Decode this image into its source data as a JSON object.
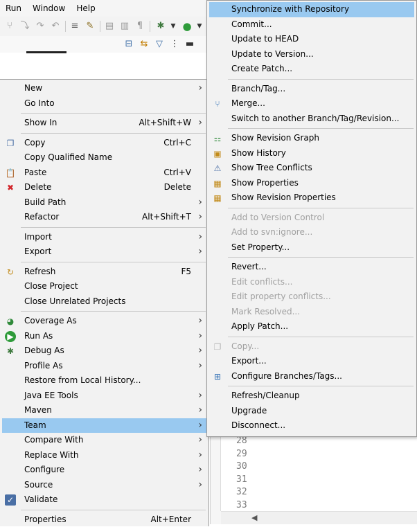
{
  "menubar": {
    "items": [
      "Run",
      "Window",
      "Help"
    ]
  },
  "editor": {
    "line_numbers": [
      "28",
      "29",
      "30",
      "31",
      "32",
      "33"
    ]
  },
  "context_menu": {
    "items": [
      {
        "label": "New",
        "accel": "",
        "submenu": true,
        "icon": ""
      },
      {
        "label": "Go Into",
        "accel": "",
        "submenu": false,
        "icon": ""
      },
      {
        "sep": true
      },
      {
        "label": "Show In",
        "accel": "Alt+Shift+W",
        "submenu": true,
        "icon": ""
      },
      {
        "sep": true
      },
      {
        "label": "Copy",
        "accel": "Ctrl+C",
        "submenu": false,
        "icon": "copy-icon"
      },
      {
        "label": "Copy Qualified Name",
        "accel": "",
        "submenu": false,
        "icon": ""
      },
      {
        "label": "Paste",
        "accel": "Ctrl+V",
        "submenu": false,
        "icon": "paste-icon"
      },
      {
        "label": "Delete",
        "accel": "Delete",
        "submenu": false,
        "icon": "delete-icon"
      },
      {
        "label": "Build Path",
        "accel": "",
        "submenu": true,
        "icon": ""
      },
      {
        "label": "Refactor",
        "accel": "Alt+Shift+T",
        "submenu": true,
        "icon": ""
      },
      {
        "sep": true
      },
      {
        "label": "Import",
        "accel": "",
        "submenu": true,
        "icon": ""
      },
      {
        "label": "Export",
        "accel": "",
        "submenu": true,
        "icon": ""
      },
      {
        "sep": true
      },
      {
        "label": "Refresh",
        "accel": "F5",
        "submenu": false,
        "icon": "refresh-icon"
      },
      {
        "label": "Close Project",
        "accel": "",
        "submenu": false,
        "icon": ""
      },
      {
        "label": "Close Unrelated Projects",
        "accel": "",
        "submenu": false,
        "icon": ""
      },
      {
        "sep": true
      },
      {
        "label": "Coverage As",
        "accel": "",
        "submenu": true,
        "icon": "coverage-icon"
      },
      {
        "label": "Run As",
        "accel": "",
        "submenu": true,
        "icon": "run-icon"
      },
      {
        "label": "Debug As",
        "accel": "",
        "submenu": true,
        "icon": "debug-icon"
      },
      {
        "label": "Profile As",
        "accel": "",
        "submenu": true,
        "icon": ""
      },
      {
        "label": "Restore from Local History...",
        "accel": "",
        "submenu": false,
        "icon": ""
      },
      {
        "label": "Java EE Tools",
        "accel": "",
        "submenu": true,
        "icon": ""
      },
      {
        "label": "Maven",
        "accel": "",
        "submenu": true,
        "icon": ""
      },
      {
        "label": "Team",
        "accel": "",
        "submenu": true,
        "icon": "",
        "highlight": true
      },
      {
        "label": "Compare With",
        "accel": "",
        "submenu": true,
        "icon": ""
      },
      {
        "label": "Replace With",
        "accel": "",
        "submenu": true,
        "icon": ""
      },
      {
        "label": "Configure",
        "accel": "",
        "submenu": true,
        "icon": ""
      },
      {
        "label": "Source",
        "accel": "",
        "submenu": true,
        "icon": ""
      },
      {
        "label": "Validate",
        "accel": "",
        "submenu": false,
        "icon": "checkmark-icon"
      },
      {
        "sep": true
      },
      {
        "label": "Properties",
        "accel": "Alt+Enter",
        "submenu": false,
        "icon": ""
      }
    ]
  },
  "team_menu": {
    "items": [
      {
        "label": "Synchronize with Repository",
        "icon": "",
        "highlight": true
      },
      {
        "label": "Commit...",
        "icon": ""
      },
      {
        "label": "Update to HEAD",
        "icon": ""
      },
      {
        "label": "Update to Version...",
        "icon": ""
      },
      {
        "label": "Create Patch...",
        "icon": ""
      },
      {
        "sep": true
      },
      {
        "label": "Branch/Tag...",
        "icon": ""
      },
      {
        "label": "Merge...",
        "icon": "merge-icon"
      },
      {
        "label": "Switch to another Branch/Tag/Revision...",
        "icon": ""
      },
      {
        "sep": true
      },
      {
        "label": "Show Revision Graph",
        "icon": "revision-graph-icon"
      },
      {
        "label": "Show History",
        "icon": "history-icon"
      },
      {
        "label": "Show Tree Conflicts",
        "icon": "tree-conflicts-icon"
      },
      {
        "label": "Show Properties",
        "icon": "properties-icon"
      },
      {
        "label": "Show Revision Properties",
        "icon": "revision-properties-icon"
      },
      {
        "sep": true
      },
      {
        "label": "Add to Version Control",
        "icon": "",
        "disabled": true
      },
      {
        "label": "Add to svn:ignore...",
        "icon": "",
        "disabled": true
      },
      {
        "label": "Set Property...",
        "icon": ""
      },
      {
        "sep": true
      },
      {
        "label": "Revert...",
        "icon": ""
      },
      {
        "label": "Edit conflicts...",
        "icon": "",
        "disabled": true
      },
      {
        "label": "Edit property conflicts...",
        "icon": "",
        "disabled": true
      },
      {
        "label": "Mark Resolved...",
        "icon": "",
        "disabled": true
      },
      {
        "label": "Apply Patch...",
        "icon": ""
      },
      {
        "sep": true
      },
      {
        "label": "Copy...",
        "icon": "copy-icon",
        "disabled": true
      },
      {
        "label": "Export...",
        "icon": ""
      },
      {
        "label": "Configure Branches/Tags...",
        "icon": "configure-branches-icon"
      },
      {
        "sep": true
      },
      {
        "label": "Refresh/Cleanup",
        "icon": ""
      },
      {
        "label": "Upgrade",
        "icon": ""
      },
      {
        "label": "Disconnect...",
        "icon": ""
      }
    ]
  },
  "colors": {
    "highlight": "#99c9f0",
    "menu_bg": "#f2f2f2",
    "disabled_text": "#a0a0a0"
  }
}
